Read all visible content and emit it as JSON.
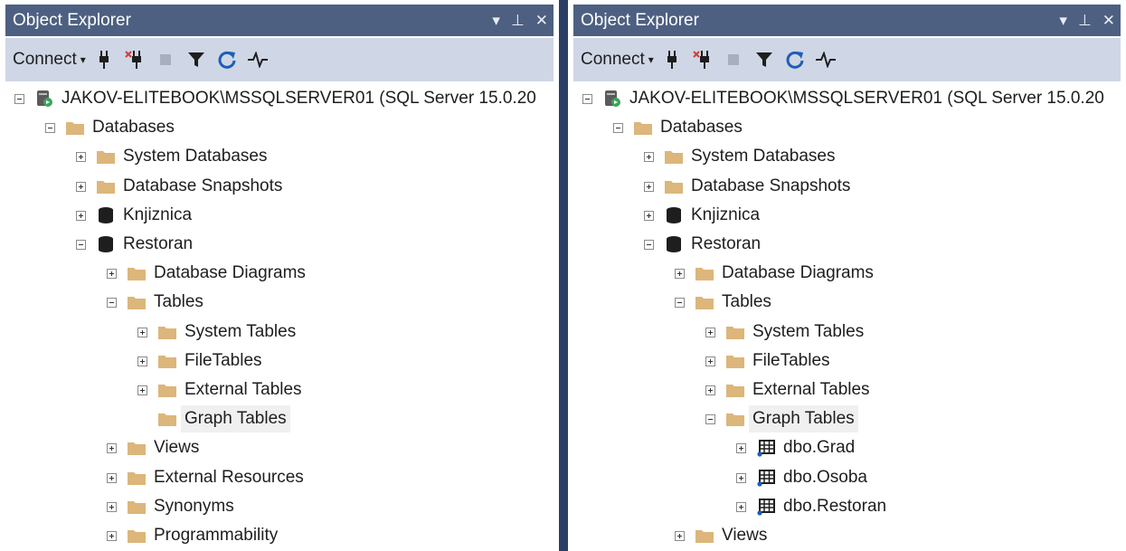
{
  "panels": [
    {
      "title": "Object Explorer",
      "toolbar": {
        "connect_label": "Connect"
      },
      "nodes": [
        {
          "label": "JAKOV-ELITEBOOK\\MSSQLSERVER01 (SQL Server 15.0.20",
          "icon": "server-icon",
          "expander": "minus",
          "depth": 0
        },
        {
          "label": "Databases",
          "icon": "folder-icon",
          "expander": "minus",
          "depth": 1
        },
        {
          "label": "System Databases",
          "icon": "folder-icon",
          "expander": "plus",
          "depth": 2
        },
        {
          "label": "Database Snapshots",
          "icon": "folder-icon",
          "expander": "plus",
          "depth": 2
        },
        {
          "label": "Knjiznica",
          "icon": "database-icon",
          "expander": "plus",
          "depth": 2
        },
        {
          "label": "Restoran",
          "icon": "database-icon",
          "expander": "minus",
          "depth": 2
        },
        {
          "label": "Database Diagrams",
          "icon": "folder-icon",
          "expander": "plus",
          "depth": 3
        },
        {
          "label": "Tables",
          "icon": "folder-icon",
          "expander": "minus",
          "depth": 3
        },
        {
          "label": "System Tables",
          "icon": "folder-icon",
          "expander": "plus",
          "depth": 4
        },
        {
          "label": "FileTables",
          "icon": "folder-icon",
          "expander": "plus",
          "depth": 4
        },
        {
          "label": "External Tables",
          "icon": "folder-icon",
          "expander": "plus",
          "depth": 4
        },
        {
          "label": "Graph Tables",
          "icon": "folder-icon",
          "expander": "none",
          "depth": 4,
          "selected": true
        },
        {
          "label": "Views",
          "icon": "folder-icon",
          "expander": "plus",
          "depth": 3
        },
        {
          "label": "External Resources",
          "icon": "folder-icon",
          "expander": "plus",
          "depth": 3
        },
        {
          "label": "Synonyms",
          "icon": "folder-icon",
          "expander": "plus",
          "depth": 3
        },
        {
          "label": "Programmability",
          "icon": "folder-icon",
          "expander": "plus",
          "depth": 3
        }
      ]
    },
    {
      "title": "Object Explorer",
      "toolbar": {
        "connect_label": "Connect"
      },
      "nodes": [
        {
          "label": "JAKOV-ELITEBOOK\\MSSQLSERVER01 (SQL Server 15.0.20",
          "icon": "server-icon",
          "expander": "minus",
          "depth": 0
        },
        {
          "label": "Databases",
          "icon": "folder-icon",
          "expander": "minus",
          "depth": 1
        },
        {
          "label": "System Databases",
          "icon": "folder-icon",
          "expander": "plus",
          "depth": 2
        },
        {
          "label": "Database Snapshots",
          "icon": "folder-icon",
          "expander": "plus",
          "depth": 2
        },
        {
          "label": "Knjiznica",
          "icon": "database-icon",
          "expander": "plus",
          "depth": 2
        },
        {
          "label": "Restoran",
          "icon": "database-icon",
          "expander": "minus",
          "depth": 2
        },
        {
          "label": "Database Diagrams",
          "icon": "folder-icon",
          "expander": "plus",
          "depth": 3
        },
        {
          "label": "Tables",
          "icon": "folder-icon",
          "expander": "minus",
          "depth": 3
        },
        {
          "label": "System Tables",
          "icon": "folder-icon",
          "expander": "plus",
          "depth": 4
        },
        {
          "label": "FileTables",
          "icon": "folder-icon",
          "expander": "plus",
          "depth": 4
        },
        {
          "label": "External Tables",
          "icon": "folder-icon",
          "expander": "plus",
          "depth": 4
        },
        {
          "label": "Graph Tables",
          "icon": "folder-icon",
          "expander": "minus",
          "depth": 4,
          "selected": true
        },
        {
          "label": "dbo.Grad",
          "icon": "table-icon",
          "expander": "plus",
          "depth": 5
        },
        {
          "label": "dbo.Osoba",
          "icon": "table-icon",
          "expander": "plus",
          "depth": 5
        },
        {
          "label": "dbo.Restoran",
          "icon": "table-icon",
          "expander": "plus",
          "depth": 5
        },
        {
          "label": "Views",
          "icon": "folder-icon",
          "expander": "plus",
          "depth": 3
        }
      ]
    }
  ],
  "colors": {
    "title_bar": "#4d6082",
    "toolbar": "#cfd6e5",
    "folder": "#dcb67a",
    "database": "#1e1e1e",
    "accent_blue": "#1c5fb8",
    "server_green": "#3aa55a"
  }
}
